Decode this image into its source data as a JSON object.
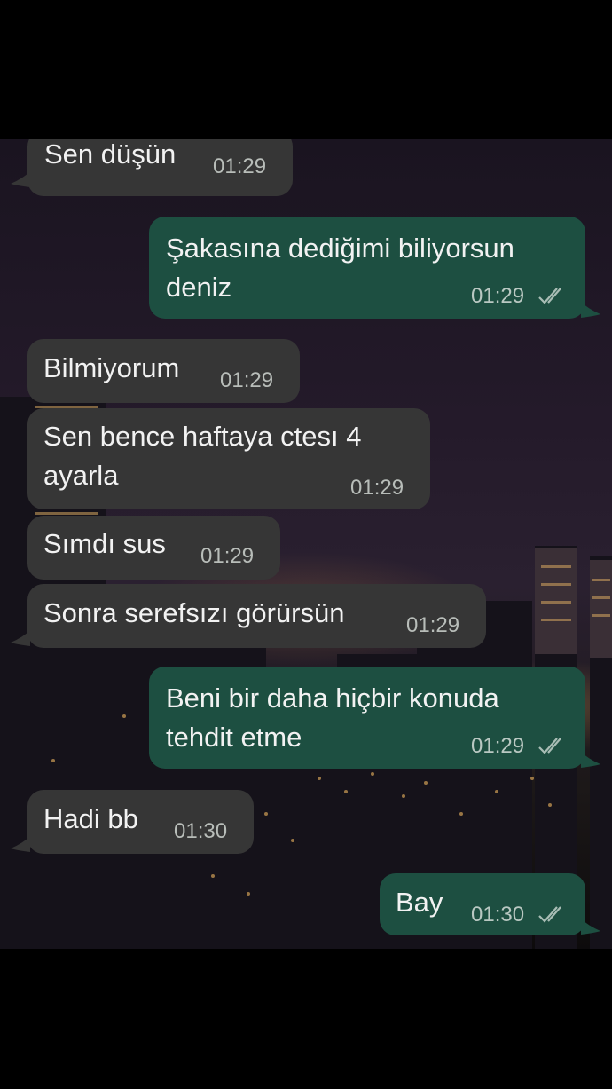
{
  "colors": {
    "incoming_bubble": "#363636",
    "outgoing_bubble": "#1d4f41",
    "text": "#f2f2f2",
    "timestamp": "#b8bdb9"
  },
  "messages": [
    {
      "direction": "incoming",
      "text": "Sen düşün",
      "time": "01:29"
    },
    {
      "direction": "outgoing",
      "text": "Şakasına dediğimi biliyorsun\ndeniz",
      "time": "01:29",
      "status_icon": "double-check-icon"
    },
    {
      "direction": "incoming",
      "text": "Bilmiyorum",
      "time": "01:29"
    },
    {
      "direction": "incoming",
      "text": "Sen bence haftaya ctesı 4\nayarla",
      "time": "01:29"
    },
    {
      "direction": "incoming",
      "text": "Sımdı sus",
      "time": "01:29"
    },
    {
      "direction": "incoming",
      "text": "Sonra serefsızı görürsün",
      "time": "01:29"
    },
    {
      "direction": "outgoing",
      "text": "Beni bir daha hiçbir konuda\ntehdit etme",
      "time": "01:29",
      "status_icon": "double-check-icon"
    },
    {
      "direction": "incoming",
      "text": "Hadi bb",
      "time": "01:30"
    },
    {
      "direction": "outgoing",
      "text": "Bay",
      "time": "01:30",
      "status_icon": "double-check-icon"
    }
  ]
}
